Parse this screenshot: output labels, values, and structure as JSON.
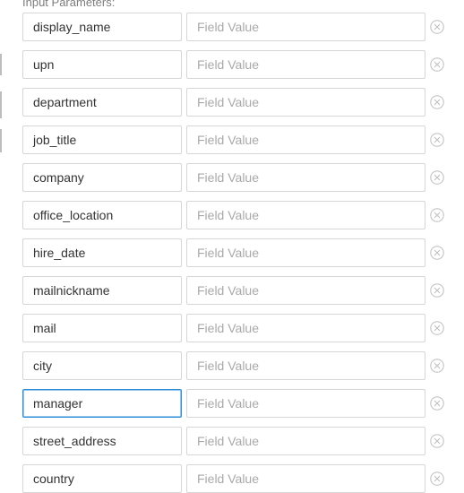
{
  "section": {
    "label": "Input Parameters:"
  },
  "rows": [
    {
      "name": "display_name",
      "value_placeholder": "Field Value"
    },
    {
      "name": "upn",
      "value_placeholder": "Field Value"
    },
    {
      "name": "department",
      "value_placeholder": "Field Value"
    },
    {
      "name": "job_title",
      "value_placeholder": "Field Value"
    },
    {
      "name": "company",
      "value_placeholder": "Field Value"
    },
    {
      "name": "office_location",
      "value_placeholder": "Field Value"
    },
    {
      "name": "hire_date",
      "value_placeholder": "Field Value"
    },
    {
      "name": "mailnickname",
      "value_placeholder": "Field Value"
    },
    {
      "name": "mail",
      "value_placeholder": "Field Value"
    },
    {
      "name": "city",
      "value_placeholder": "Field Value"
    },
    {
      "name": "manager",
      "value_placeholder": "Field Value",
      "focused": true
    },
    {
      "name": "street_address",
      "value_placeholder": "Field Value"
    },
    {
      "name": "country",
      "value_placeholder": "Field Value"
    }
  ],
  "colors": {
    "focus_border": "#2f8fd6",
    "field_border": "#d6d6d6",
    "placeholder_text": "#a9a9a9",
    "remove_icon": "#c4c4c4"
  },
  "icons": {
    "remove": "circle-x-icon"
  }
}
